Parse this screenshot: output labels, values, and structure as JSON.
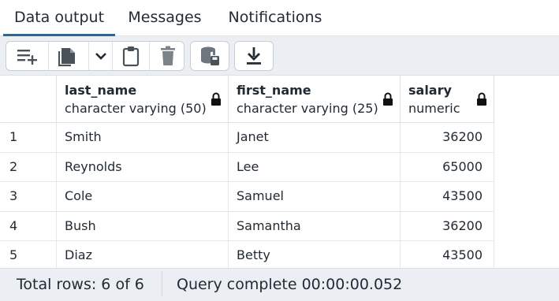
{
  "tabs": [
    {
      "label": "Data output",
      "active": true
    },
    {
      "label": "Messages",
      "active": false
    },
    {
      "label": "Notifications",
      "active": false
    }
  ],
  "toolbar": {
    "icons": [
      "add-row-icon",
      "copy-icon",
      "chevron-down-icon",
      "paste-icon",
      "delete-icon",
      "save-data-icon",
      "download-icon"
    ]
  },
  "grid": {
    "columns": [
      {
        "name": "last_name",
        "type": "character varying (50)"
      },
      {
        "name": "first_name",
        "type": "character varying (25)"
      },
      {
        "name": "salary",
        "type": "numeric"
      }
    ],
    "rows": [
      {
        "n": "1",
        "cells": [
          "Smith",
          "Janet",
          "36200"
        ]
      },
      {
        "n": "2",
        "cells": [
          "Reynolds",
          "Lee",
          "65000"
        ]
      },
      {
        "n": "3",
        "cells": [
          "Cole",
          "Samuel",
          "43500"
        ]
      },
      {
        "n": "4",
        "cells": [
          "Bush",
          "Samantha",
          "36200"
        ]
      },
      {
        "n": "5",
        "cells": [
          "Diaz",
          "Betty",
          "43500"
        ]
      }
    ]
  },
  "status": {
    "total_rows": "Total rows: 6 of 6",
    "query": "Query complete 00:00:00.052"
  },
  "colors": {
    "accent": "#326690",
    "toolbar_bg": "#ebeef3",
    "icon": "#4a5259"
  }
}
